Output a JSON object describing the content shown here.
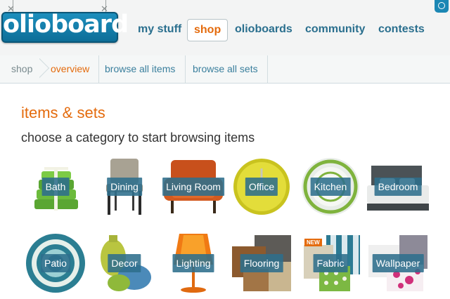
{
  "header": {
    "logo_text": "olioboard",
    "nav": [
      {
        "label": "my stuff"
      },
      {
        "label": "shop",
        "active": true
      },
      {
        "label": "olioboards"
      },
      {
        "label": "community"
      },
      {
        "label": "contests"
      }
    ]
  },
  "subnav": {
    "crumbs": [
      {
        "label": "shop"
      },
      {
        "label": "overview",
        "active": true
      },
      {
        "label": "browse all items"
      },
      {
        "label": "browse all sets"
      }
    ]
  },
  "main": {
    "title": "items & sets",
    "subtitle": "choose a category to start browsing items",
    "categories": [
      {
        "label": "Bath",
        "icon": "towels-icon"
      },
      {
        "label": "Dining",
        "icon": "dining-chair-icon"
      },
      {
        "label": "Living Room",
        "icon": "armchair-icon"
      },
      {
        "label": "Office",
        "icon": "wall-clock-icon"
      },
      {
        "label": "Kitchen",
        "icon": "plate-icon"
      },
      {
        "label": "Bedroom",
        "icon": "bed-icon"
      },
      {
        "label": "Patio",
        "icon": "umbrella-icon"
      },
      {
        "label": "Decor",
        "icon": "vases-icon"
      },
      {
        "label": "Lighting",
        "icon": "lamp-icon"
      },
      {
        "label": "Flooring",
        "icon": "floor-tiles-icon"
      },
      {
        "label": "Fabric",
        "icon": "fabric-swatches-icon",
        "tag": "NEW"
      },
      {
        "label": "Wallpaper",
        "icon": "wallpaper-swatches-icon"
      }
    ]
  },
  "colors": {
    "accent": "#e46b0d",
    "link": "#2a6f8e",
    "brand": "#1d8fbd",
    "badge": "#2d6e8c"
  }
}
